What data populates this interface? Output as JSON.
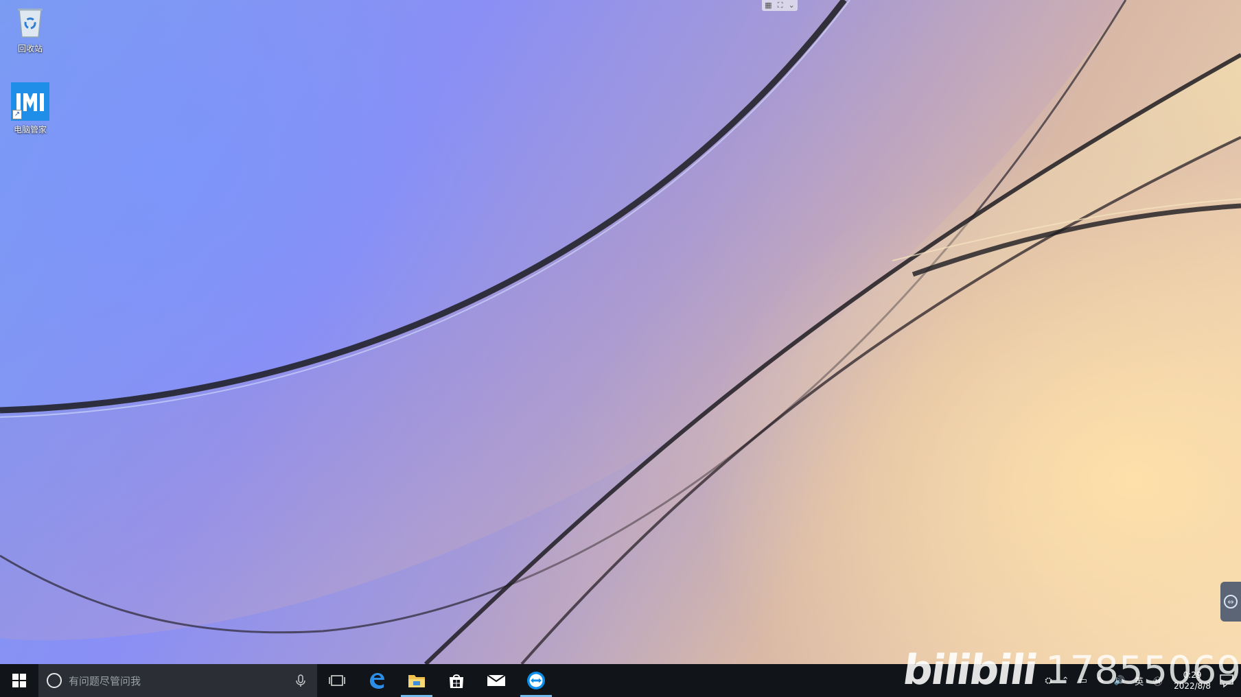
{
  "desktop": {
    "icons": [
      {
        "label": "回收站",
        "icon": "recycle-bin-icon"
      },
      {
        "label": "电脑管家",
        "icon": "tencent-pc-manager-icon"
      }
    ]
  },
  "taskbar": {
    "search_placeholder": "有问题尽管问我",
    "apps": [
      {
        "icon": "task-view-icon",
        "active": false
      },
      {
        "icon": "edge-icon",
        "active": false
      },
      {
        "icon": "file-explorer-icon",
        "active": true
      },
      {
        "icon": "microsoft-store-icon",
        "active": false
      },
      {
        "icon": "mail-icon",
        "active": false
      },
      {
        "icon": "teamviewer-icon",
        "active": true
      }
    ],
    "tray": {
      "input_lang": "英",
      "clock_time": "0:29",
      "clock_date": "2022/8/8"
    }
  },
  "watermark": {
    "logo_text": "bilibili",
    "uid": "17855069"
  },
  "colors": {
    "taskbar_bg": "#111418",
    "search_bg": "#2b2f35",
    "accent": "#76b9ed",
    "guanjia_blue": "#1f8ee8"
  }
}
